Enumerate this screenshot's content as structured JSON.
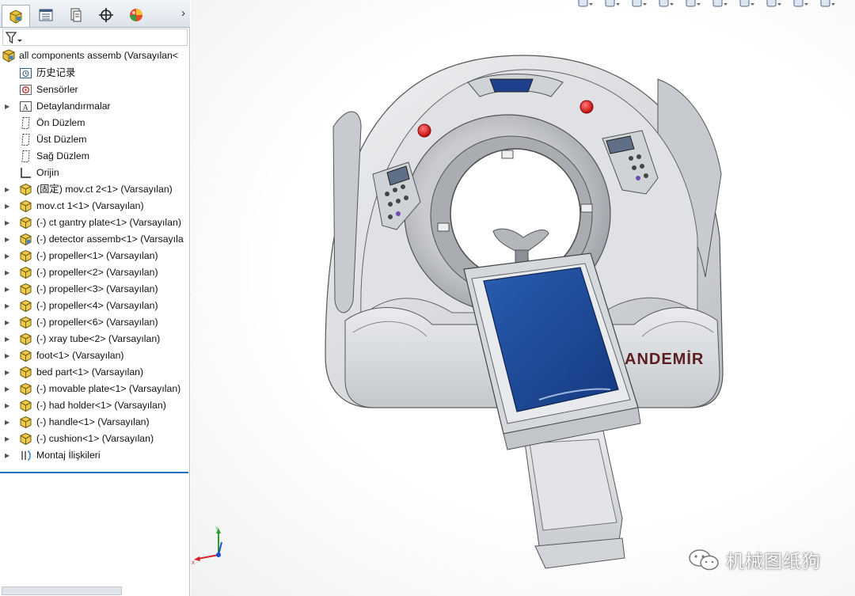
{
  "tabs": [
    {
      "name": "feature-manager",
      "icon": "assembly-cube-icon",
      "active": true
    },
    {
      "name": "property-manager",
      "icon": "property-list-icon"
    },
    {
      "name": "configuration-manager",
      "icon": "configuration-icon"
    },
    {
      "name": "dimxpert-manager",
      "icon": "crosshair-icon"
    },
    {
      "name": "display-manager",
      "icon": "appearance-ball-icon"
    }
  ],
  "tree": {
    "root": "all components assemb  (Varsayılan<",
    "items": [
      {
        "label": "历史记录",
        "icon": "history-icon",
        "expand": false
      },
      {
        "label": "Sensörler",
        "icon": "sensor-icon",
        "expand": false
      },
      {
        "label": "Detaylandırmalar",
        "icon": "annotation-icon",
        "expand": true
      },
      {
        "label": "Ön Düzlem",
        "icon": "plane-icon",
        "expand": false
      },
      {
        "label": "Üst Düzlem",
        "icon": "plane-icon",
        "expand": false
      },
      {
        "label": "Sağ Düzlem",
        "icon": "plane-icon",
        "expand": false
      },
      {
        "label": "Orijin",
        "icon": "origin-icon",
        "expand": false
      },
      {
        "label": "(固定) mov.ct 2<1> (Varsayılan)",
        "icon": "part-icon",
        "expand": true
      },
      {
        "label": "mov.ct 1<1> (Varsayılan)",
        "icon": "part-icon",
        "expand": true
      },
      {
        "label": "(-) ct gantry plate<1> (Varsayılan)",
        "icon": "part-icon",
        "expand": true
      },
      {
        "label": "(-) detector assemb<1> (Varsayıla",
        "icon": "subassembly-icon",
        "expand": true
      },
      {
        "label": "(-) propeller<1> (Varsayılan)",
        "icon": "part-icon",
        "expand": true
      },
      {
        "label": "(-) propeller<2> (Varsayılan)",
        "icon": "part-icon",
        "expand": true
      },
      {
        "label": "(-) propeller<3> (Varsayılan)",
        "icon": "part-icon",
        "expand": true
      },
      {
        "label": "(-) propeller<4> (Varsayılan)",
        "icon": "part-icon",
        "expand": true
      },
      {
        "label": "(-) propeller<6> (Varsayılan)",
        "icon": "part-icon",
        "expand": true
      },
      {
        "label": "(-) xray tube<2> (Varsayılan)",
        "icon": "part-icon",
        "expand": true
      },
      {
        "label": "foot<1> (Varsayılan)",
        "icon": "part-icon",
        "expand": true
      },
      {
        "label": "bed part<1> (Varsayılan)",
        "icon": "part-icon",
        "expand": true
      },
      {
        "label": "(-) movable plate<1> (Varsayılan)",
        "icon": "part-icon",
        "expand": true
      },
      {
        "label": "(-) had holder<1> (Varsayılan)",
        "icon": "part-icon",
        "expand": true
      },
      {
        "label": "(-) handle<1> (Varsayılan)",
        "icon": "part-icon",
        "expand": true
      },
      {
        "label": "(-) cushion<1> (Varsayılan)",
        "icon": "part-icon",
        "expand": true
      },
      {
        "label": "Montaj İlişkileri",
        "icon": "mates-icon",
        "expand": true
      }
    ]
  },
  "hud_icons": [
    "zoom-to-fit-icon",
    "zoom-area-icon",
    "previous-view-icon",
    "section-view-icon",
    "view-orientation-icon",
    "display-style-icon",
    "hide-show-icon",
    "edit-appearance-icon",
    "apply-scene-icon",
    "view-settings-icon"
  ],
  "model": {
    "brand": "ANDEMİR",
    "colors": {
      "shell": "#d9dadc",
      "screen": "#1e3f8c",
      "cushion": "#1c4a9a",
      "light": "#e01b1b",
      "brand": "#5b1d1d"
    }
  },
  "watermark": {
    "text": "机械图纸狗",
    "icon": "wechat-icon"
  }
}
